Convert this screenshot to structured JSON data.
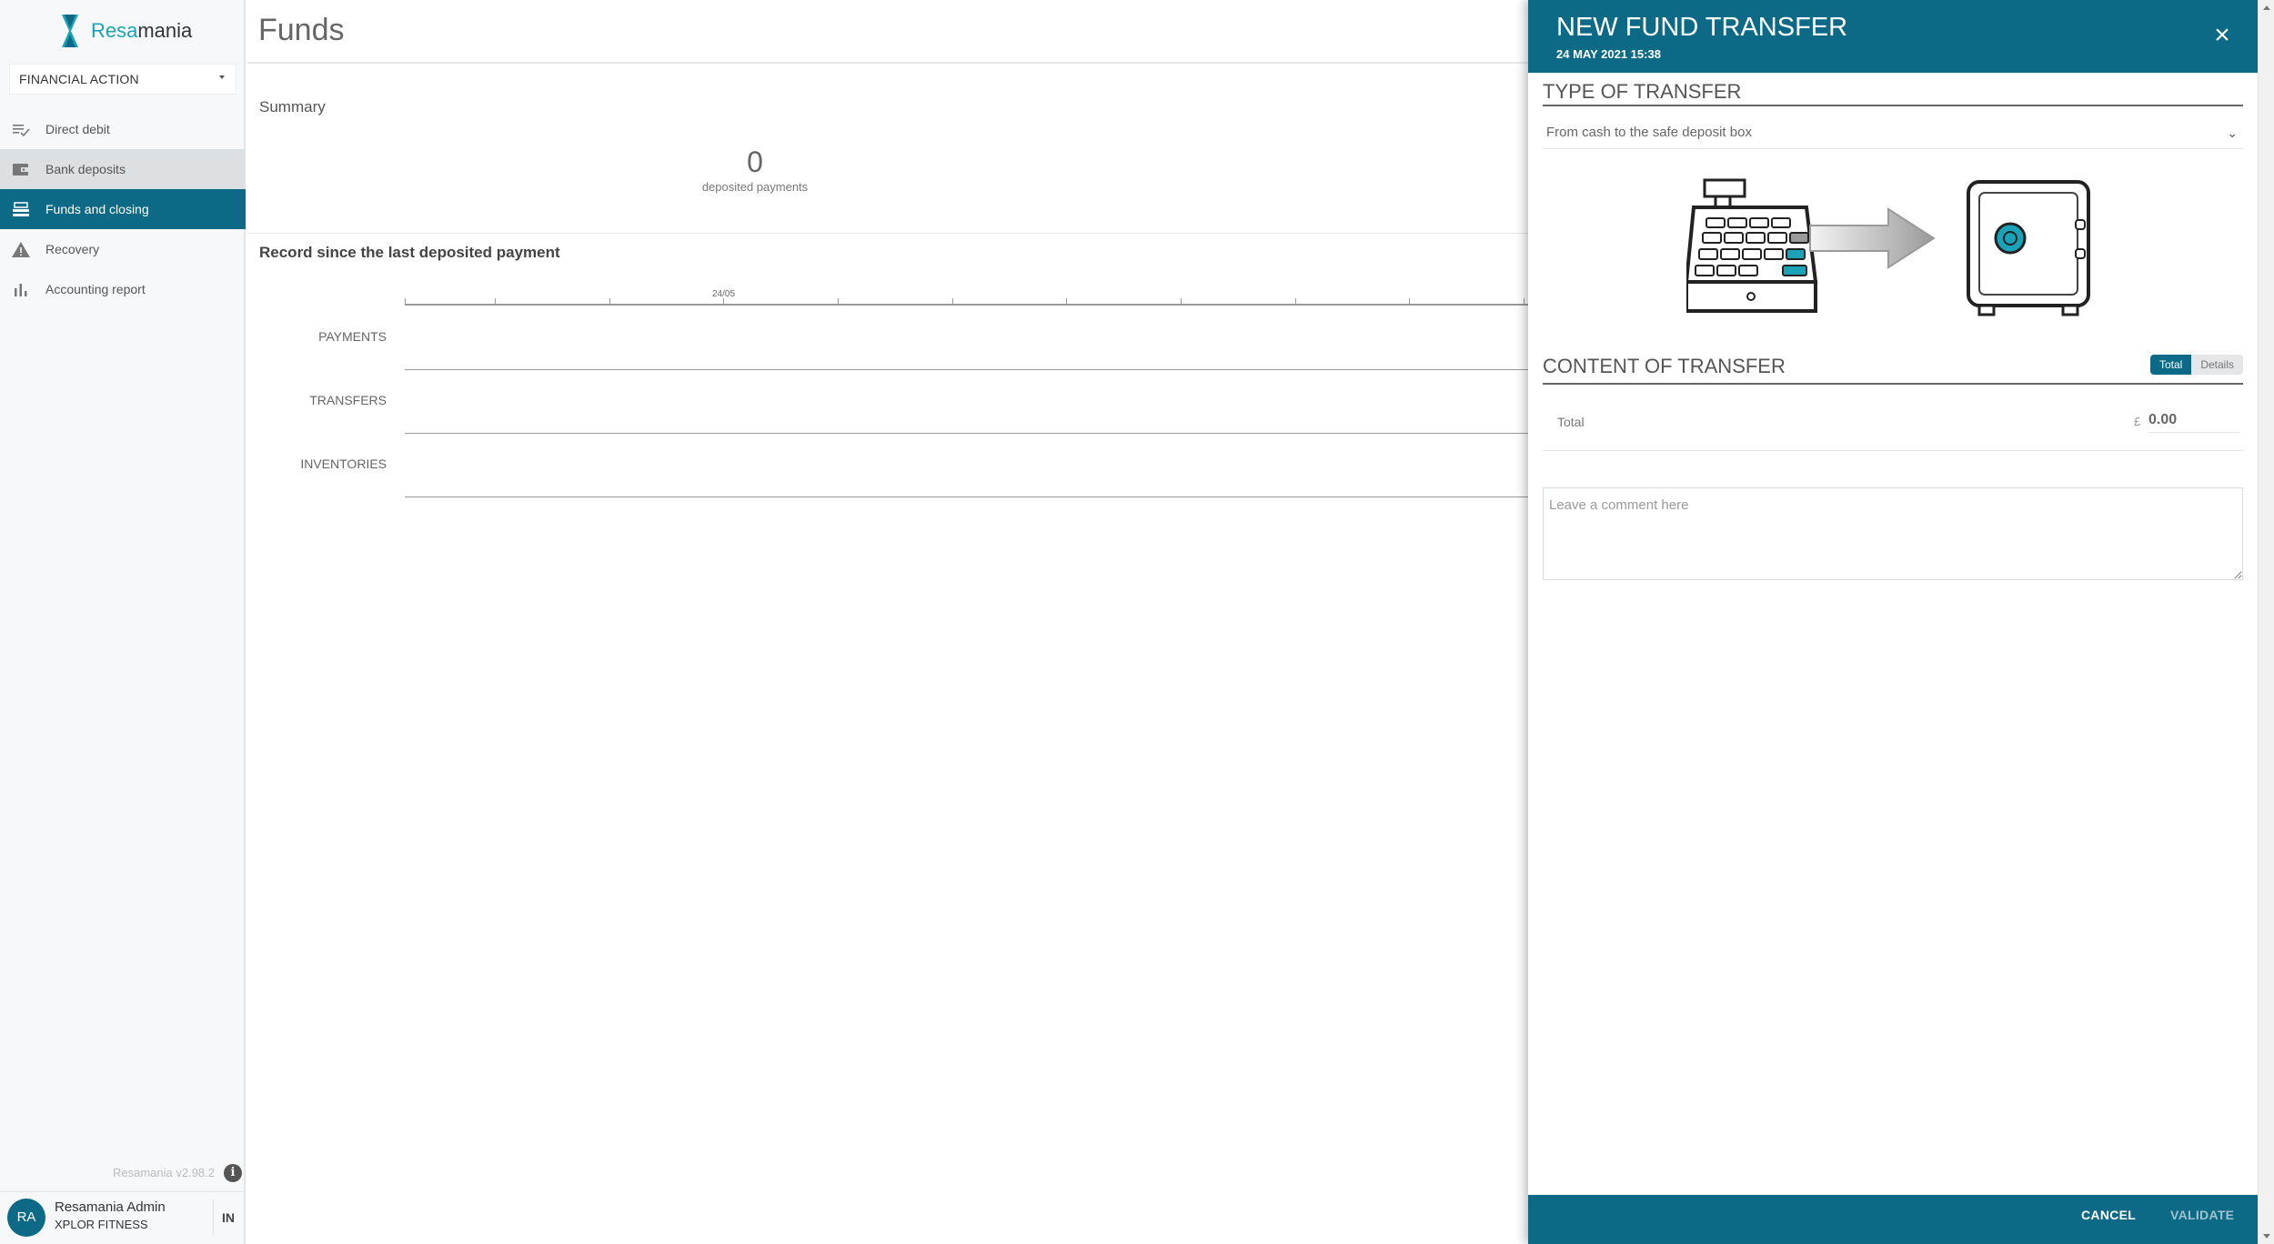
{
  "app": {
    "logo_prefix": "Resa",
    "logo_suffix": "mania",
    "version": "Resamania v2.98.2"
  },
  "sidebar": {
    "action_select": "FINANCIAL ACTION",
    "items": [
      {
        "label": "Direct debit",
        "icon": "checklist-icon"
      },
      {
        "label": "Bank deposits",
        "icon": "wallet-icon"
      },
      {
        "label": "Funds and closing",
        "icon": "cash-register-icon"
      },
      {
        "label": "Recovery",
        "icon": "warning-icon"
      },
      {
        "label": "Accounting report",
        "icon": "bar-chart-icon"
      }
    ],
    "active_index": 2
  },
  "user": {
    "initials": "RA",
    "name": "Resamania Admin",
    "organization": "XPLOR FITNESS",
    "language": "IN"
  },
  "main": {
    "title": "Funds",
    "summary_title": "Summary",
    "kpi_value": "0",
    "kpi_label": "deposited payments",
    "record_title": "Record since the last deposited payment",
    "timeline_tick_label": "24/05",
    "rows": [
      "PAYMENTS",
      "TRANSFERS",
      "INVENTORIES"
    ]
  },
  "panel": {
    "title": "NEW FUND TRANSFER",
    "date": "24 MAY 2021 15:38",
    "type_section": "TYPE OF TRANSFER",
    "type_value": "From cash to the safe deposit box",
    "content_section": "CONTENT OF TRANSFER",
    "toggle_total": "Total",
    "toggle_details": "Details",
    "total_label": "Total",
    "currency": "£",
    "total_value": "0.00",
    "comment_placeholder": "Leave a comment here",
    "cancel_label": "CANCEL",
    "validate_label": "VALIDATE",
    "accent_color": "#0c6a86",
    "illustration_accent": "#1aa3b8"
  }
}
